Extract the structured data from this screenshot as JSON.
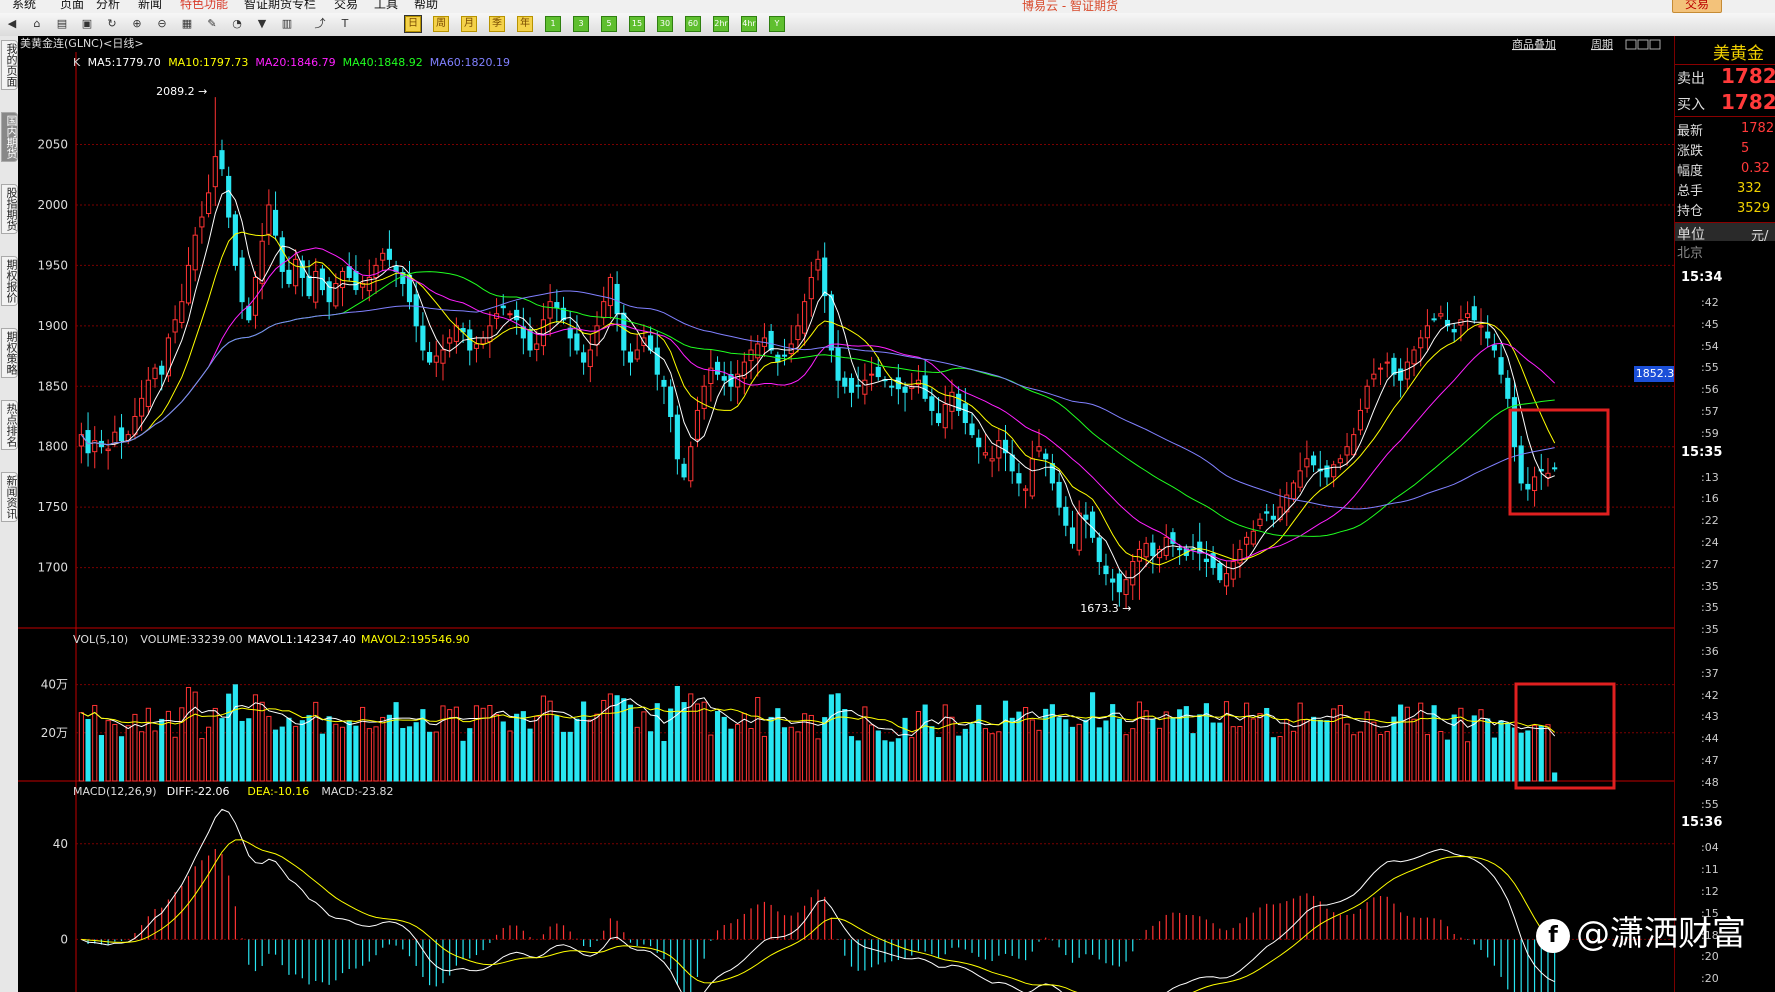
{
  "menu": {
    "items": [
      "系统",
      "页面",
      "分析",
      "新闻",
      "特色功能",
      "智证期货专栏",
      "交易",
      "工具",
      "帮助"
    ],
    "brand": "博易云 - 智证期货",
    "trade_label": "交易"
  },
  "toolbar": {
    "periods": [
      "日",
      "周",
      "月",
      "季",
      "年",
      "1",
      "3",
      "5",
      "15",
      "30",
      "60",
      "2hr",
      "4hr",
      "Y"
    ]
  },
  "sidetabs": [
    "我的页面",
    "国内期货",
    "股指期货",
    "期权报价",
    "期权策略",
    "热点排名",
    "新闻资讯"
  ],
  "chart_header": {
    "instrument": "美黄金连(GLNC)<日线>",
    "links": [
      "商品叠加",
      "周期"
    ]
  },
  "quote_panel": {
    "title": "美黄金",
    "sell_label": "卖出",
    "sell_value": "1782.",
    "buy_label": "买入",
    "buy_value": "1782.",
    "rows": [
      {
        "label": "最新",
        "value": "1782"
      },
      {
        "label": "涨跌",
        "value": "5"
      },
      {
        "label": "幅度",
        "value": "0.32"
      },
      {
        "label": "总手",
        "value": "332"
      },
      {
        "label": "持仓",
        "value": "3529"
      }
    ],
    "unit_label": "单位",
    "unit_value": "元/",
    "city": "北京",
    "ticks": [
      {
        "t": "15:34",
        "big": true
      },
      {
        "t": ":42"
      },
      {
        "t": ":45"
      },
      {
        "t": ":54"
      },
      {
        "t": ":55"
      },
      {
        "t": ":56"
      },
      {
        "t": ":57"
      },
      {
        "t": ":59"
      },
      {
        "t": "15:35",
        "big": true
      },
      {
        "t": ":13"
      },
      {
        "t": ":16"
      },
      {
        "t": ":22"
      },
      {
        "t": ":24"
      },
      {
        "t": ":27"
      },
      {
        "t": ":35"
      },
      {
        "t": ":35"
      },
      {
        "t": ":35"
      },
      {
        "t": ":36"
      },
      {
        "t": ":37"
      },
      {
        "t": ":42"
      },
      {
        "t": ":43"
      },
      {
        "t": ":44"
      },
      {
        "t": ":47"
      },
      {
        "t": ":48"
      },
      {
        "t": ":55"
      },
      {
        "t": "15:36",
        "big": true
      },
      {
        "t": ":04"
      },
      {
        "t": ":11"
      },
      {
        "t": ":12"
      },
      {
        "t": ":15"
      },
      {
        "t": ":18"
      },
      {
        "t": ":20"
      },
      {
        "t": ":20"
      }
    ]
  },
  "price_badge": "1852.3",
  "watermark": "@潇洒财富",
  "colors": {
    "up": "#ff3333",
    "down": "#28e6f2",
    "ma5": "#ffffff",
    "ma10": "#ffff00",
    "ma20": "#ff20ff",
    "ma40": "#20ff20",
    "ma60": "#8080ff",
    "grid": "#7a0000",
    "highlight": "#e02020"
  },
  "chart_data": [
    {
      "type": "candlestick",
      "panel": "price",
      "legend": [
        "K",
        "MA5:1779.70",
        "MA10:1797.73",
        "MA20:1846.79",
        "MA40:1848.92",
        "MA60:1820.19"
      ],
      "ylim": [
        1650,
        2110
      ],
      "yticks": [
        1700,
        1750,
        1800,
        1850,
        1900,
        1950,
        2000,
        2050
      ],
      "annotations": [
        {
          "label": "2089.2",
          "bar": 20,
          "value": 2089.2
        },
        {
          "label": "1673.3",
          "bar": 158,
          "value": 1673.3
        }
      ],
      "close": [
        1810,
        1795,
        1805,
        1800,
        1798,
        1812,
        1805,
        1810,
        1825,
        1840,
        1855,
        1865,
        1860,
        1890,
        1905,
        1920,
        1950,
        1975,
        1990,
        2010,
        2040,
        2030,
        1990,
        1950,
        1920,
        1905,
        1940,
        1970,
        2000,
        1975,
        1945,
        1935,
        1955,
        1940,
        1925,
        1945,
        1930,
        1920,
        1935,
        1945,
        1940,
        1930,
        1935,
        1940,
        1950,
        1960,
        1955,
        1945,
        1935,
        1920,
        1900,
        1880,
        1870,
        1875,
        1880,
        1890,
        1900,
        1895,
        1880,
        1885,
        1890,
        1900,
        1910,
        1915,
        1910,
        1905,
        1890,
        1880,
        1885,
        1905,
        1920,
        1915,
        1905,
        1890,
        1880,
        1870,
        1880,
        1900,
        1920,
        1940,
        1910,
        1880,
        1870,
        1880,
        1890,
        1880,
        1860,
        1850,
        1825,
        1790,
        1775,
        1800,
        1830,
        1850,
        1865,
        1860,
        1855,
        1850,
        1860,
        1870,
        1880,
        1885,
        1890,
        1880,
        1870,
        1875,
        1885,
        1900,
        1920,
        1940,
        1955,
        1925,
        1880,
        1855,
        1850,
        1845,
        1850,
        1855,
        1860,
        1858,
        1855,
        1850,
        1848,
        1845,
        1850,
        1855,
        1840,
        1830,
        1820,
        1835,
        1845,
        1830,
        1820,
        1810,
        1800,
        1795,
        1790,
        1805,
        1795,
        1780,
        1770,
        1765,
        1790,
        1800,
        1790,
        1770,
        1750,
        1735,
        1720,
        1745,
        1740,
        1725,
        1705,
        1695,
        1688,
        1680,
        1690,
        1705,
        1715,
        1720,
        1710,
        1715,
        1725,
        1720,
        1715,
        1710,
        1715,
        1712,
        1705,
        1700,
        1690,
        1695,
        1705,
        1715,
        1725,
        1730,
        1740,
        1745,
        1740,
        1750,
        1760,
        1770,
        1780,
        1790,
        1785,
        1780,
        1775,
        1785,
        1790,
        1800,
        1810,
        1830,
        1850,
        1860,
        1865,
        1870,
        1860,
        1855,
        1870,
        1880,
        1890,
        1900,
        1905,
        1910,
        1900,
        1895,
        1905,
        1910,
        1905,
        1900,
        1890,
        1880,
        1860,
        1840,
        1800,
        1770,
        1765,
        1775,
        1780,
        1778,
        1782
      ]
    },
    {
      "type": "bar",
      "panel": "volume",
      "legend": [
        "VOL(5,10)",
        "VOLUME:33239.00",
        "MAVOL1:142347.40",
        "MAVOL2:195546.90"
      ],
      "yticks_labels": [
        "20万",
        "40万"
      ],
      "yticks": [
        200000,
        400000
      ],
      "ylim": [
        0,
        560000
      ]
    },
    {
      "type": "bar",
      "panel": "macd",
      "legend": [
        "MACD(12,26,9)",
        "DIFF:-22.06",
        "DEA:-10.16",
        "MACD:-23.82"
      ],
      "yticks": [
        0,
        40
      ],
      "ylim": [
        -22,
        60
      ]
    }
  ]
}
